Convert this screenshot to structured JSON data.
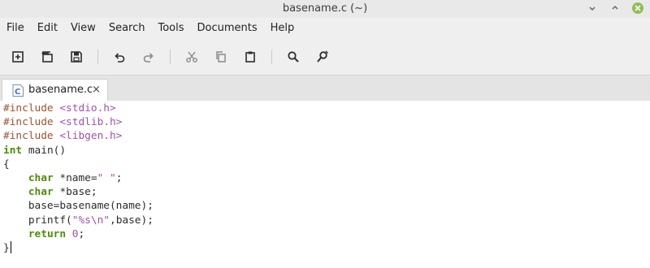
{
  "window": {
    "title": "basename.c (~)"
  },
  "menu": {
    "items": [
      "File",
      "Edit",
      "View",
      "Search",
      "Tools",
      "Documents",
      "Help"
    ]
  },
  "toolbar": {
    "buttons": [
      "new-document",
      "open-document",
      "save",
      "undo",
      "redo",
      "cut",
      "copy",
      "paste",
      "find",
      "find-replace"
    ]
  },
  "tabs": [
    {
      "label": "basename.c",
      "close": "×",
      "icon_letter": "C"
    }
  ],
  "colors": {
    "close_button": "#8cbe55",
    "keyword": "#4c8e05",
    "preprocessor": "#a0522d",
    "string": "#a051a8"
  },
  "code": {
    "lines": [
      [
        {
          "t": "#include ",
          "c": "pp"
        },
        {
          "t": "<stdio.h>",
          "c": "str"
        }
      ],
      [
        {
          "t": "#include ",
          "c": "pp"
        },
        {
          "t": "<stdlib.h>",
          "c": "str"
        }
      ],
      [
        {
          "t": "#include ",
          "c": "pp"
        },
        {
          "t": "<libgen.h>",
          "c": "str"
        }
      ],
      [
        {
          "t": "int",
          "c": "kw"
        },
        {
          "t": " main()",
          "c": ""
        }
      ],
      [
        {
          "t": "{",
          "c": ""
        }
      ],
      [
        {
          "t": "    ",
          "c": ""
        },
        {
          "t": "char",
          "c": "kw"
        },
        {
          "t": " *name=",
          "c": ""
        },
        {
          "t": "\" \"",
          "c": "str"
        },
        {
          "t": ";",
          "c": ""
        }
      ],
      [
        {
          "t": "    ",
          "c": ""
        },
        {
          "t": "char",
          "c": "kw"
        },
        {
          "t": " *base;",
          "c": ""
        }
      ],
      [
        {
          "t": "    base=basename(name);",
          "c": ""
        }
      ],
      [
        {
          "t": "    printf(",
          "c": ""
        },
        {
          "t": "\"%s\\n\"",
          "c": "str"
        },
        {
          "t": ",base);",
          "c": ""
        }
      ],
      [
        {
          "t": "    ",
          "c": ""
        },
        {
          "t": "return",
          "c": "kw"
        },
        {
          "t": " ",
          "c": ""
        },
        {
          "t": "0",
          "c": "num"
        },
        {
          "t": ";",
          "c": ""
        }
      ],
      [
        {
          "t": "}",
          "c": ""
        },
        {
          "t": "",
          "c": "cursor"
        }
      ]
    ]
  }
}
